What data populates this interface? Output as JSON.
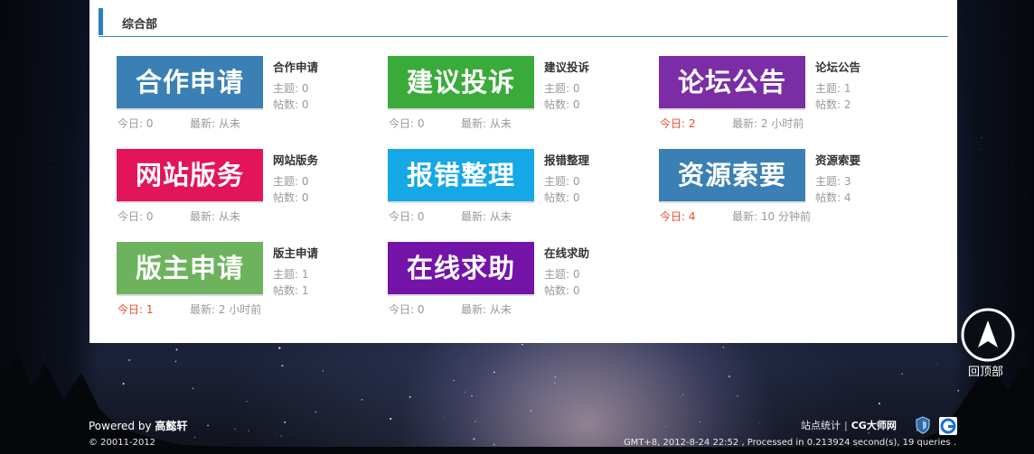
{
  "section": {
    "title": "综合部"
  },
  "forums": [
    {
      "banner": "合作申请",
      "color": "#3a80b4",
      "name": "合作申请",
      "topics_label": "主题: 0",
      "posts_label": "帖数: 0",
      "today": "今日: 0",
      "latest": "最新: 从未",
      "today_hot": false
    },
    {
      "banner": "建议投诉",
      "color": "#3aab3a",
      "name": "建议投诉",
      "topics_label": "主题: 0",
      "posts_label": "帖数: 0",
      "today": "今日: 0",
      "latest": "最新: 从未",
      "today_hot": false
    },
    {
      "banner": "论坛公告",
      "color": "#7a2da4",
      "name": "论坛公告",
      "topics_label": "主题: 1",
      "posts_label": "帖数: 2",
      "today": "今日: 2",
      "latest": "最新: 2 小时前",
      "today_hot": true
    },
    {
      "banner": "网站版务",
      "color": "#e3155a",
      "name": "网站版务",
      "topics_label": "主题: 0",
      "posts_label": "帖数: 0",
      "today": "今日: 0",
      "latest": "最新: 从未",
      "today_hot": false
    },
    {
      "banner": "报错整理",
      "color": "#14a8e6",
      "name": "报错整理",
      "topics_label": "主题: 0",
      "posts_label": "帖数: 0",
      "today": "今日: 0",
      "latest": "最新: 从未",
      "today_hot": false
    },
    {
      "banner": "资源索要",
      "color": "#3a80b4",
      "name": "资源索要",
      "topics_label": "主题: 3",
      "posts_label": "帖数: 4",
      "today": "今日: 4",
      "latest": "最新: 10 分钟前",
      "today_hot": true
    },
    {
      "banner": "版主申请",
      "color": "#6db35e",
      "name": "版主申请",
      "topics_label": "主题: 1",
      "posts_label": "帖数: 1",
      "today": "今日: 1",
      "latest": "最新: 2 小时前",
      "today_hot": true
    },
    {
      "banner": "在线求助",
      "color": "#7413a8",
      "name": "在线求助",
      "topics_label": "主题: 0",
      "posts_label": "帖数: 0",
      "today": "今日: 0",
      "latest": "最新: 从未",
      "today_hot": false
    }
  ],
  "footer": {
    "powered_prefix": "Powered by",
    "powered_name": "高懿轩",
    "copyright": "© 20011-2012",
    "stats_link": "站点统计",
    "site_name": "CG大师网",
    "gmt_info": "GMT+8, 2012-8-24 22:52 , Processed in 0.213924 second(s), 19 queries ."
  },
  "back_to_top": {
    "label": "回顶部",
    "icon": "navigation-arrow-icon"
  }
}
